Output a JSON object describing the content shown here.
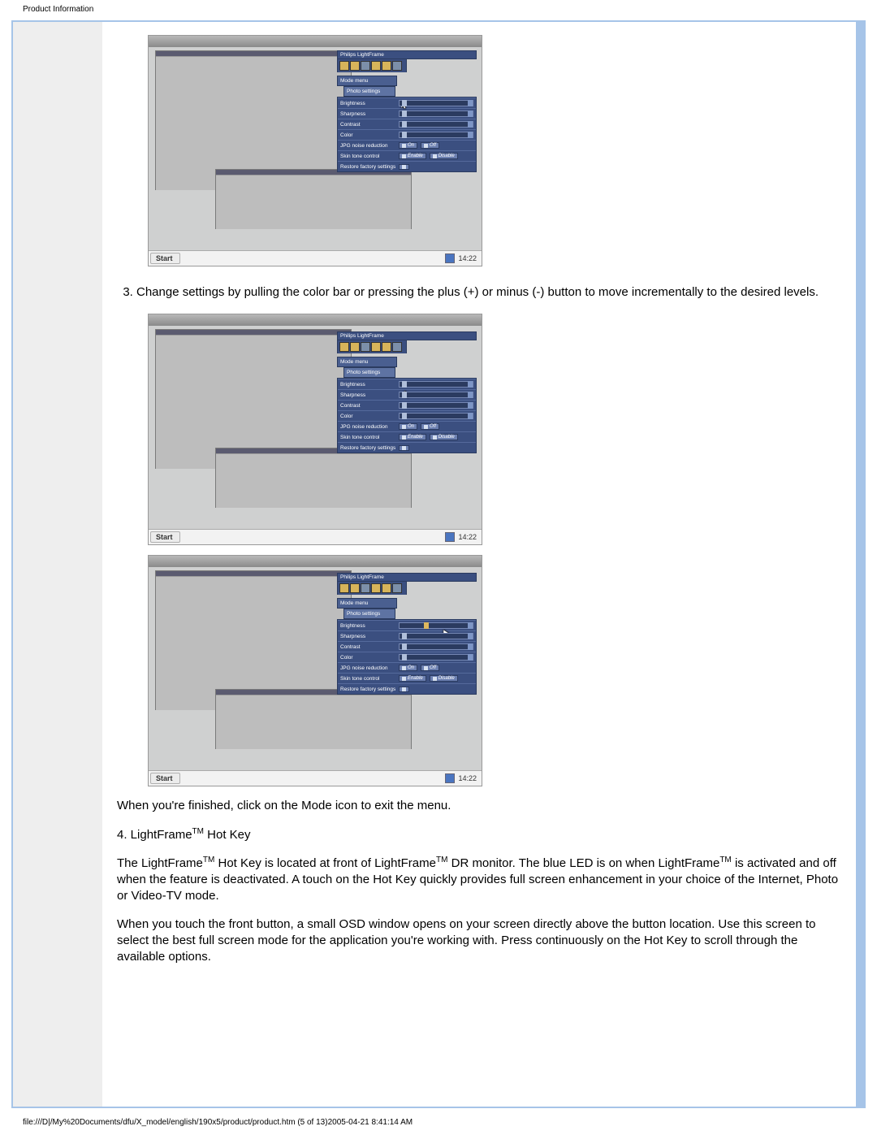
{
  "header_title": "Product Information",
  "step_text": "Change settings by pulling the color bar or pressing the plus (+) or minus (-) button to move incrementally to the desired levels.",
  "after_text": "When you're finished, click on the Mode icon to exit the menu.",
  "section4_heading_a": "4. LightFrame",
  "section4_heading_tm": "TM",
  "section4_heading_b": " Hot Key",
  "para2_a": "The LightFrame",
  "para2_b": " Hot Key is located at front of LightFrame",
  "para2_c": " DR monitor. The blue LED is on when LightFrame",
  "para2_d": " is activated and off when the feature is deactivated. A touch on the Hot Key quickly provides full screen enhancement in your choice of the Internet, Photo or Video-TV mode.",
  "para3": "When you touch the front button, a small OSD window opens on your screen directly above the button location. Use this screen to select the best full screen mode for the application you're working with. Press continuously on the Hot Key to scroll through the available options.",
  "panel": {
    "title": "Philips LightFrame",
    "menu": "Mode menu",
    "submenu": "Photo settings",
    "rows": {
      "brightness": "Brightness",
      "sharpness": "Sharpness",
      "contrast": "Contrast",
      "color": "Color",
      "jpgnoise": "JPG noise reduction",
      "skin": "Skin tone control",
      "restore": "Restore factory settings"
    },
    "opts": {
      "on": "On",
      "off": "Off",
      "enable": "Enable",
      "disable": "Disable"
    }
  },
  "taskbar": {
    "start": "Start",
    "clock": "14:22"
  },
  "footer": "file:///D|/My%20Documents/dfu/X_model/english/190x5/product/product.htm (5 of 13)2005-04-21 8:41:14 AM"
}
